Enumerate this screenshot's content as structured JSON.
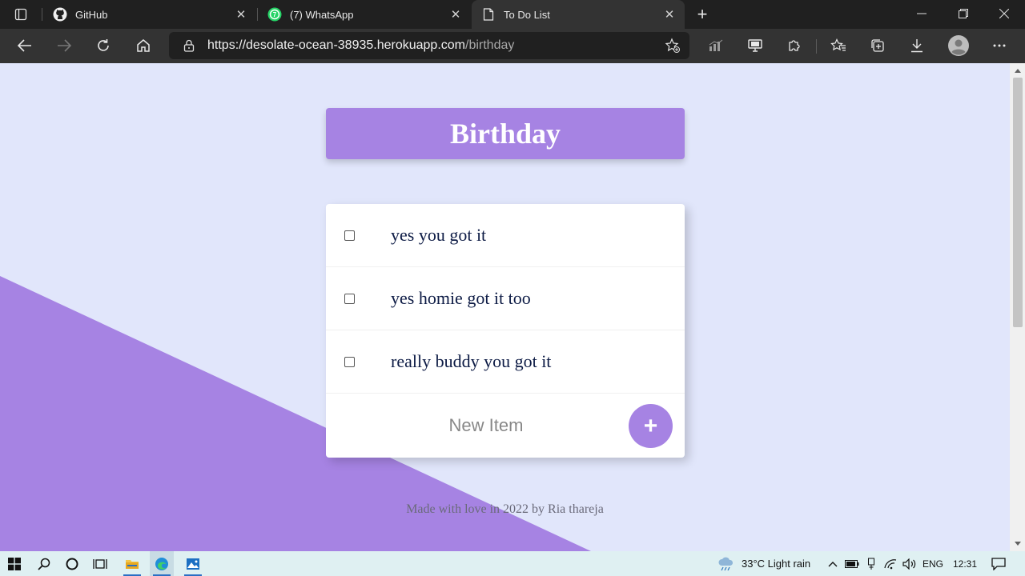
{
  "browser": {
    "tabs": [
      {
        "label": "GitHub",
        "icon": "github-icon",
        "active": false
      },
      {
        "label": "(7) WhatsApp",
        "icon": "whatsapp-icon",
        "active": false
      },
      {
        "label": "To Do List",
        "icon": "document-icon",
        "active": true
      }
    ],
    "url_host": "https://desolate-ocean-38935.herokuapp.com",
    "url_path": "/birthday"
  },
  "page": {
    "title": "Birthday",
    "items": [
      {
        "text": "yes you got it",
        "checked": false
      },
      {
        "text": "yes homie got it too",
        "checked": false
      },
      {
        "text": "really buddy you got it",
        "checked": false
      }
    ],
    "new_item_placeholder": "New Item",
    "add_button_label": "+",
    "footer": "Made with love in 2022 by Ria thareja",
    "colors": {
      "accent": "#a683e3",
      "background": "#e1e6fb",
      "card": "#ffffff",
      "text": "#0d1b45"
    }
  },
  "taskbar": {
    "weather": "33°C  Light rain",
    "language": "ENG",
    "time": "12:31"
  }
}
